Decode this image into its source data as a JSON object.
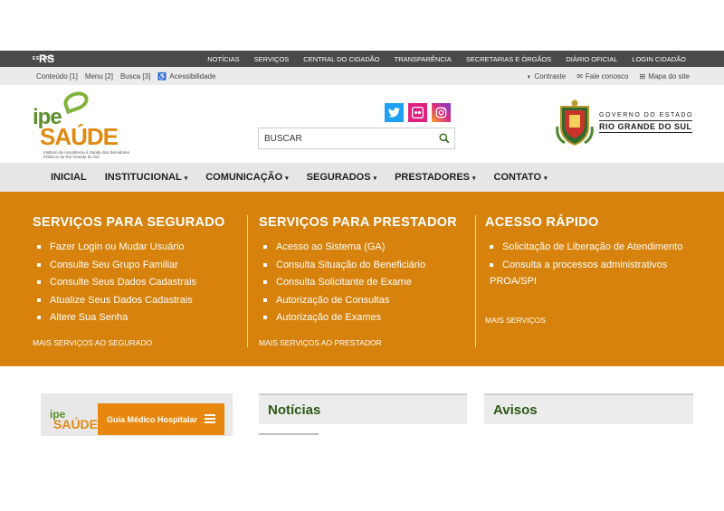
{
  "govbar": {
    "logo_small": "ESTADO",
    "logo_text": "RS",
    "links": [
      "NOTÍCIAS",
      "SERVIÇOS",
      "CENTRAL DO CIDADÃO",
      "TRANSPARÊNCIA",
      "SECRETARIAS E ÓRGÃOS",
      "DIÁRIO OFICIAL",
      "LOGIN CIDADÃO"
    ]
  },
  "accessbar": {
    "left": [
      "Conteúdo [1]",
      "Menu [2]",
      "Busca [3]"
    ],
    "accessibility": "Acessibilidade",
    "contrast": "Contraste",
    "contact": "Fale conosco",
    "sitemap": "Mapa do site"
  },
  "header": {
    "logo_ipe": "ipe",
    "logo_saude": "SAÚDE",
    "logo_tagline": "Instituto de Assistência à Saúde dos Servidores Públicos do Rio Grande do Sul",
    "search_placeholder": "BUSCAR",
    "gov_line1": "GOVERNO DO ESTADO",
    "gov_line2": "RIO GRANDE DO SUL"
  },
  "mainnav": {
    "items": [
      {
        "label": "INICIAL",
        "caret": ""
      },
      {
        "label": "INSTITUCIONAL",
        "caret": "▾"
      },
      {
        "label": "COMUNICAÇÃO",
        "caret": "▾"
      },
      {
        "label": "SEGURADOS",
        "caret": "▾"
      },
      {
        "label": "PRESTADORES",
        "caret": "▾"
      },
      {
        "label": "CONTATO",
        "caret": "▾"
      }
    ]
  },
  "services": {
    "segurado": {
      "title": "SERVIÇOS PARA SEGURADO",
      "items": [
        "Fazer Login ou Mudar Usuário",
        "Consulte Seu Grupo Familiar",
        "Consulte Seus Dados Cadastrais",
        "Atualize Seus Dados Cadastrais",
        "Altere Sua Senha"
      ],
      "more": "MAIS SERVIÇOS AO SEGURADO"
    },
    "prestador": {
      "title": "SERVIÇOS PARA PRESTADOR",
      "items": [
        "Acesso ao Sistema (GA)",
        "Consulta Situação do Beneficiário",
        "Consulta Solicitante de Exame",
        "Autorização de Consultas",
        "Autorização de Exames"
      ],
      "more": "MAIS SERVIÇOS AO PRESTADOR"
    },
    "rapido": {
      "title": "ACESSO RÁPIDO",
      "items": [
        "Solicitação de Liberação de Atendimento",
        "Consulta a processos administrativos PROA/SPI"
      ],
      "more": "MAIS SERVIÇOS"
    }
  },
  "guia": {
    "logo_ipe": "ipe",
    "logo_saude": "SAÚDE",
    "label": "Guia Médico Hospitalar"
  },
  "panels": {
    "news_title": "Notícias",
    "avisos_title": "Avisos"
  },
  "colors": {
    "orange": "#d6820c",
    "green": "#2c5a16",
    "govbar": "#4a4a4a"
  }
}
